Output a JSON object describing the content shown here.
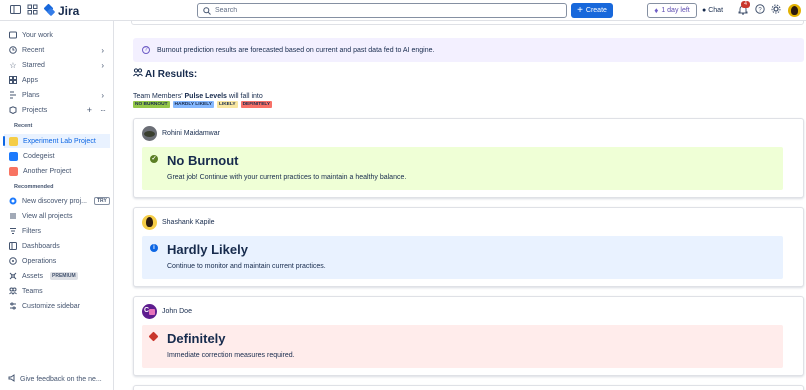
{
  "topbar": {
    "app_name": "Jira",
    "search_placeholder": "Search",
    "create_label": "Create",
    "trial_label": "1 day left",
    "chat_label": "Chat",
    "notification_count": "4"
  },
  "sidebar": {
    "items": [
      {
        "label": "Your work",
        "icon": "your-work-icon"
      },
      {
        "label": "Recent",
        "icon": "clock-icon"
      },
      {
        "label": "Starred",
        "icon": "star-icon"
      },
      {
        "label": "Apps",
        "icon": "apps-icon"
      },
      {
        "label": "Plans",
        "icon": "plans-icon"
      },
      {
        "label": "Projects",
        "icon": "projects-icon"
      }
    ],
    "recent_label": "Recent",
    "recent_projects": [
      {
        "label": "Experiment Lab Project",
        "color": "#f5cd47"
      },
      {
        "label": "Codegeist",
        "color": "#1d7afc"
      },
      {
        "label": "Another Project",
        "color": "#f87462"
      }
    ],
    "recommended_label": "Recommended",
    "recommended": {
      "label": "New discovery proj...",
      "tag": "TRY"
    },
    "view_all": "View all projects",
    "bottom_items": [
      {
        "label": "Filters",
        "icon": "filter-icon"
      },
      {
        "label": "Dashboards",
        "icon": "dashboard-icon"
      },
      {
        "label": "Operations",
        "icon": "operations-icon"
      },
      {
        "label": "Assets",
        "icon": "assets-icon",
        "tag": "PREMIUM"
      },
      {
        "label": "Teams",
        "icon": "teams-icon"
      },
      {
        "label": "Customize sidebar",
        "icon": "customize-icon"
      }
    ],
    "feedback": "Give feedback on the ne..."
  },
  "main": {
    "info_banner": "Burnout prediction results are forecasted based on current and past data fed to AI engine.",
    "ai_heading": "AI Results:",
    "pulse_prefix": "Team Members' ",
    "pulse_bold": "Pulse Levels",
    "pulse_suffix": " will fall into",
    "pulse_tags": [
      {
        "label": "NO BURNOUT",
        "color": "#94c748"
      },
      {
        "label": "HARDLY LIKELY",
        "color": "#85b8ff"
      },
      {
        "label": "LIKELY",
        "color": "#f8e6a0"
      },
      {
        "label": "DEFINITELY",
        "color": "#f87168"
      }
    ],
    "results": [
      {
        "name": "Rohini Maidamwar",
        "title": "No Burnout",
        "desc": "Great job! Continue with your current practices to maintain a healthy balance.",
        "bg": "#efffd6",
        "icon_color": "#5b7f24",
        "icon": "check-circle-icon"
      },
      {
        "name": "Shashank Kapile",
        "title": "Hardly Likely",
        "desc": "Continue to monitor and maintain current practices.",
        "bg": "#e9f2ff",
        "icon_color": "#0c66e4",
        "icon": "info-icon"
      },
      {
        "name": "John Doe",
        "title": "Definitely",
        "desc": "Immediate correction measures required.",
        "bg": "#ffeceb",
        "icon_color": "#c9372c",
        "icon": "error-icon"
      }
    ]
  }
}
